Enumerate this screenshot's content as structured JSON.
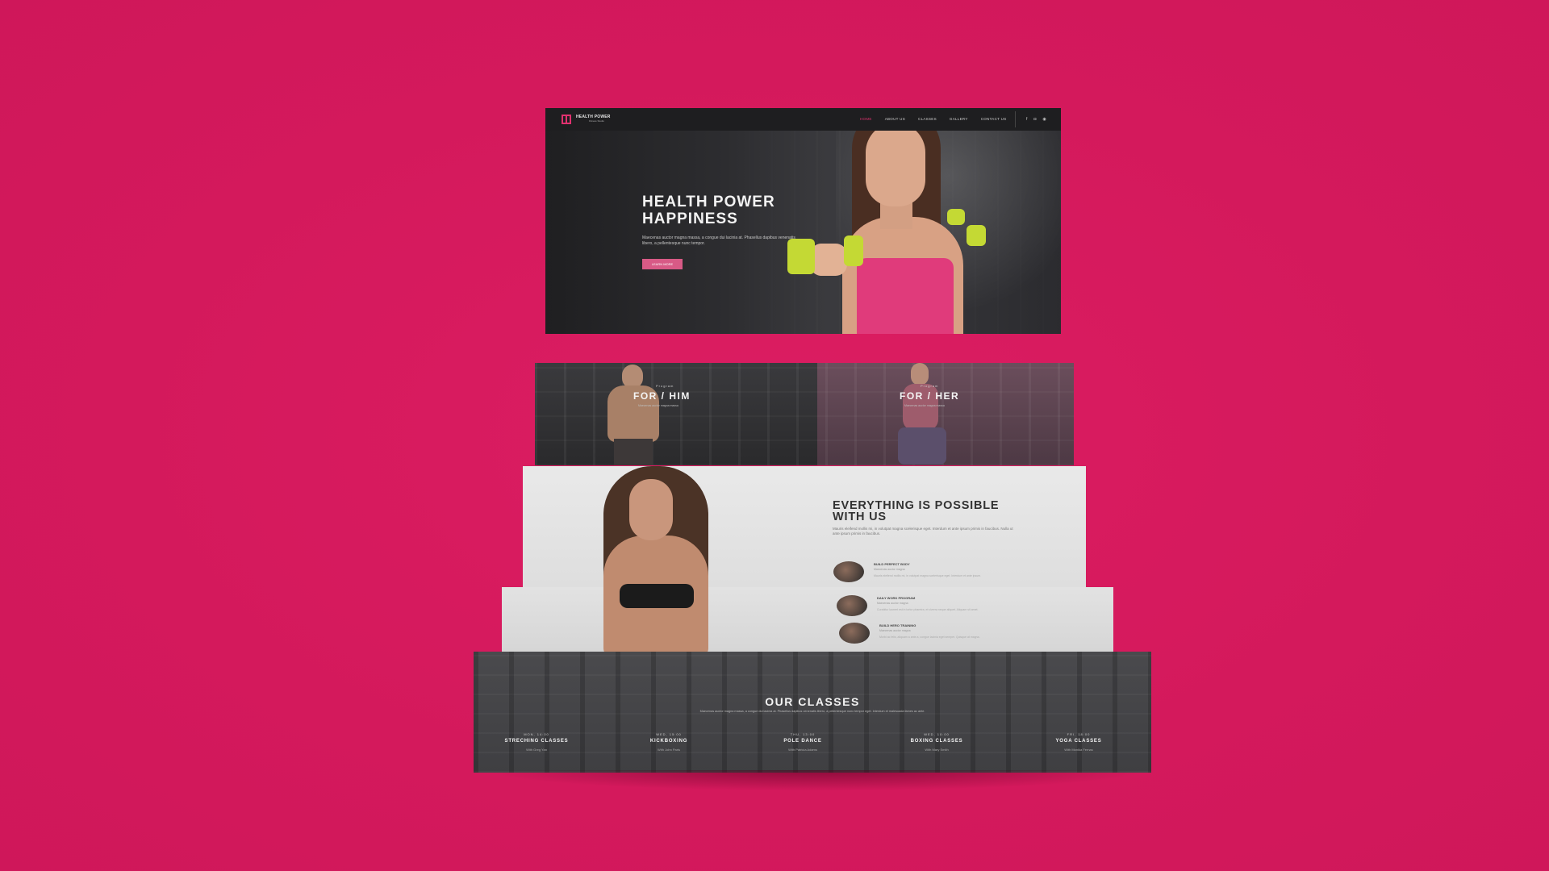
{
  "brand": {
    "name": "HEALTH POWER",
    "tagline": "Fitness Studio"
  },
  "nav": {
    "items": [
      "HOME",
      "ABOUT US",
      "CLASSES",
      "GALLERY",
      "CONTACT US"
    ],
    "active": 0,
    "social": [
      "f",
      "◘",
      "◉"
    ]
  },
  "hero": {
    "title": "HEALTH POWER HAPPINESS",
    "text": "Maecenas auctor magna massa, a congue dui lacinia at. Phasellus dapibus venenatis libero, a pellentesque nunc tempor.",
    "button": "LEARN MORE"
  },
  "programs": [
    {
      "label": "Program",
      "title": "FOR / HIM",
      "subtitle": "Maecenas auctor magna massa"
    },
    {
      "label": "Program",
      "title": "FOR / HER",
      "subtitle": "Maecenas auctor magna massa"
    }
  ],
  "possible": {
    "title": "EVERYTHING IS POSSIBLE WITH US",
    "text": "Mauris eleifend mollis mi, in volutpat magna scelerisque eget. Interdum et ante ipsum primis in faucibus. Nulla ut ante ipsum primis in faucibus.",
    "features": [
      {
        "title": "BUILD PERFECT BODY",
        "subtitle": "Maecenas auctor magna",
        "text": "Mauris eleifend mollis mi, in volutpat magna scelerisque eget. Interdum et ante ipsum."
      },
      {
        "title": "DAILY WORK PROGRAM",
        "subtitle": "Maecenas auctor magna",
        "text": "Curabitur laoreet est in tortor pharetra, et viverra neque aliquet. Aliquam sit amet."
      },
      {
        "title": "BUILD HERO TRAINING",
        "subtitle": "Maecenas auctor magna",
        "text": "Morbi ac felis, aliquam a ante a, congue lacinia eget semper. Quisque at magna."
      }
    ]
  },
  "classes": {
    "title": "OUR CLASSES",
    "text": "Maecenas auctor magna massa, a congue dui lacinia at. Phasellus dapibus venenatis libero, a pellentesque nunc tempor eget. Interdum et malesuada fames ac ante.",
    "items": [
      {
        "time": "MON, 14:00",
        "name": "STRECHING CLASSES",
        "trainer": "With Greg Yan"
      },
      {
        "time": "WED, 15:00",
        "name": "KICKBOXING",
        "trainer": "With John Paris"
      },
      {
        "time": "THU, 13:00",
        "name": "POLE DANCE",
        "trainer": "With Patricia Adams"
      },
      {
        "time": "WED, 10:00",
        "name": "BOXING CLASSES",
        "trainer": "With Mary Smith"
      },
      {
        "time": "FRI, 18:00",
        "name": "YOGA CLASSES",
        "trainer": "With Monika Fernas"
      }
    ]
  },
  "colors": {
    "background": "#d81b60",
    "accent": "#e0316f"
  }
}
